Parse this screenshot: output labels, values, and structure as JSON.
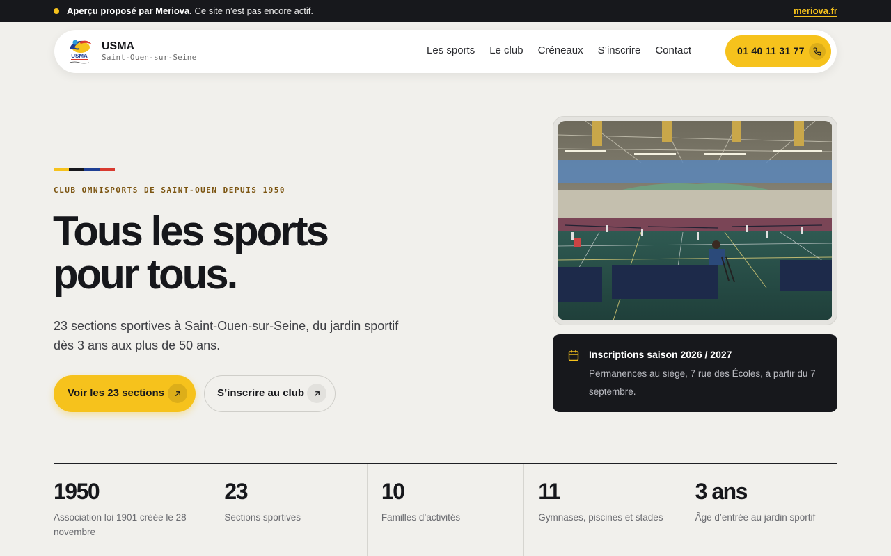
{
  "banner": {
    "strong": "Aperçu proposé par Meriova.",
    "text": " Ce site n’est pas encore actif.",
    "link": "meriova.fr"
  },
  "nav": {
    "logo_icon": "usma-logo",
    "brand": "USMA",
    "subtitle": "Saint-Ouen-sur-Seine",
    "links": [
      "Les sports",
      "Le club",
      "Créneaux",
      "S’inscrire",
      "Contact"
    ],
    "phone": "01 40 11 31 77",
    "phone_icon": "phone-icon"
  },
  "hero": {
    "stripe_colors": [
      "#f6c21c",
      "#17181c",
      "#1f3f93",
      "#d83a2f"
    ],
    "eyebrow": "CLUB OMNISPORTS DE SAINT-OUEN DEPUIS 1950",
    "title_line1": "Tous les sports",
    "title_line2": "pour tous.",
    "subtitle": "23 sections sportives à Saint-Ouen-sur-Seine, du jardin sportif dès 3 ans aux plus de 50 ans.",
    "primary_button": "Voir les 23 sections",
    "secondary_button": "S’inscrire au club"
  },
  "info_card": {
    "icon": "calendar-icon",
    "title": "Inscriptions saison 2026 / 2027",
    "text": "Permanences au siège, 7 rue des Écoles, à partir du 7 septembre."
  },
  "stats": [
    {
      "value": "1950",
      "label": "Association loi 1901 créée le 28 novembre"
    },
    {
      "value": "23",
      "label": "Sections sportives"
    },
    {
      "value": "10",
      "label": "Familles d’activités"
    },
    {
      "value": "11",
      "label": "Gymnases, piscines et stades"
    },
    {
      "value": "3 ans",
      "label": "Âge d’entrée au jardin sportif"
    }
  ],
  "colors": {
    "accent": "#f6c21c",
    "dark": "#17181c",
    "background": "#f1f0ec"
  }
}
